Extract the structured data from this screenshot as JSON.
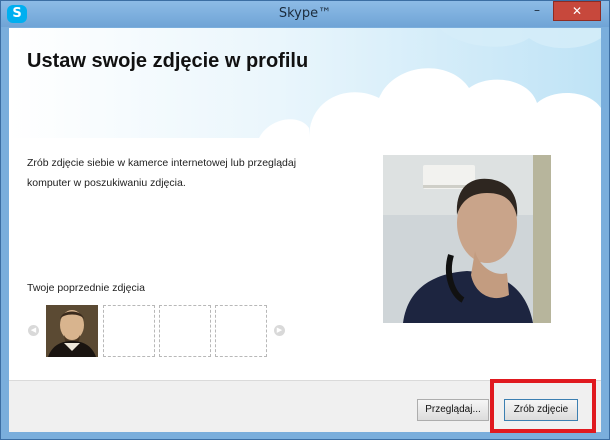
{
  "window": {
    "title": "Skype™",
    "app_icon_letter": "S",
    "min_glyph": "–",
    "close_glyph": "✕"
  },
  "main": {
    "heading": "Ustaw swoje zdjęcie w profilu",
    "description": "Zrób zdjęcie siebie w kamerce internetowej lub przeglądaj komputer w poszukiwaniu zdjęcia.",
    "previous_label": "Twoje poprzednie zdjęcia",
    "arrow_left_glyph": "◀",
    "arrow_right_glyph": "▶"
  },
  "footer": {
    "browse_label": "Przeglądaj...",
    "take_photo_label": "Zrób zdjęcie"
  },
  "colors": {
    "accent": "#00aff0",
    "highlight": "#e0191f"
  }
}
